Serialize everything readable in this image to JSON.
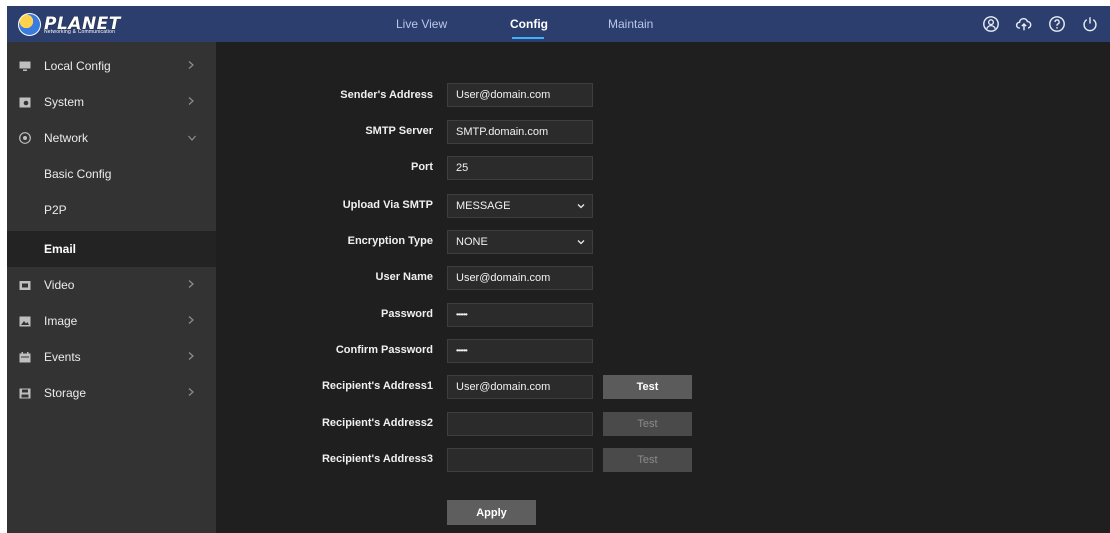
{
  "header": {
    "logo_text": "PLANET",
    "logo_subtitle": "Networking & Communication",
    "tabs": [
      {
        "label": "Live View"
      },
      {
        "label": "Config"
      },
      {
        "label": "Maintain"
      }
    ],
    "active_tab": "Config",
    "icons": [
      "user-icon",
      "cloud-icon",
      "help-icon",
      "power-icon"
    ]
  },
  "sidebar": {
    "items": [
      {
        "label": "Local Config",
        "icon": "monitor-icon",
        "expanded": false
      },
      {
        "label": "System",
        "icon": "system-icon",
        "expanded": false
      },
      {
        "label": "Network",
        "icon": "network-icon",
        "expanded": true
      },
      {
        "label": "Basic Config"
      },
      {
        "label": "P2P"
      },
      {
        "label": "Email",
        "active": true
      },
      {
        "label": "Video",
        "icon": "video-icon",
        "expanded": false
      },
      {
        "label": "Image",
        "icon": "image-icon",
        "expanded": false
      },
      {
        "label": "Events",
        "icon": "events-icon",
        "expanded": false
      },
      {
        "label": "Storage",
        "icon": "storage-icon",
        "expanded": false
      }
    ]
  },
  "form": {
    "sender_address": {
      "label": "Sender's Address",
      "value": "User@domain.com"
    },
    "smtp_server": {
      "label": "SMTP Server",
      "value": "SMTP.domain.com"
    },
    "port": {
      "label": "Port",
      "value": "25"
    },
    "upload_via_smtp": {
      "label": "Upload Via SMTP",
      "value": "MESSAGE"
    },
    "encryption_type": {
      "label": "Encryption Type",
      "value": "NONE"
    },
    "user_name": {
      "label": "User Name",
      "value": "User@domain.com"
    },
    "password": {
      "label": "Password",
      "value": "••••••"
    },
    "confirm_password": {
      "label": "Confirm Password",
      "value": "••••••"
    },
    "recipient1": {
      "label": "Recipient's Address1",
      "value": "User@domain.com",
      "test_label": "Test"
    },
    "recipient2": {
      "label": "Recipient's Address2",
      "value": "",
      "test_label": "Test"
    },
    "recipient3": {
      "label": "Recipient's Address3",
      "value": "",
      "test_label": "Test"
    },
    "apply_label": "Apply"
  },
  "colors": {
    "topbar": "#2c3e6d",
    "sidebar": "#333333",
    "content": "#1f1f1f",
    "accent": "#3db1ff"
  }
}
